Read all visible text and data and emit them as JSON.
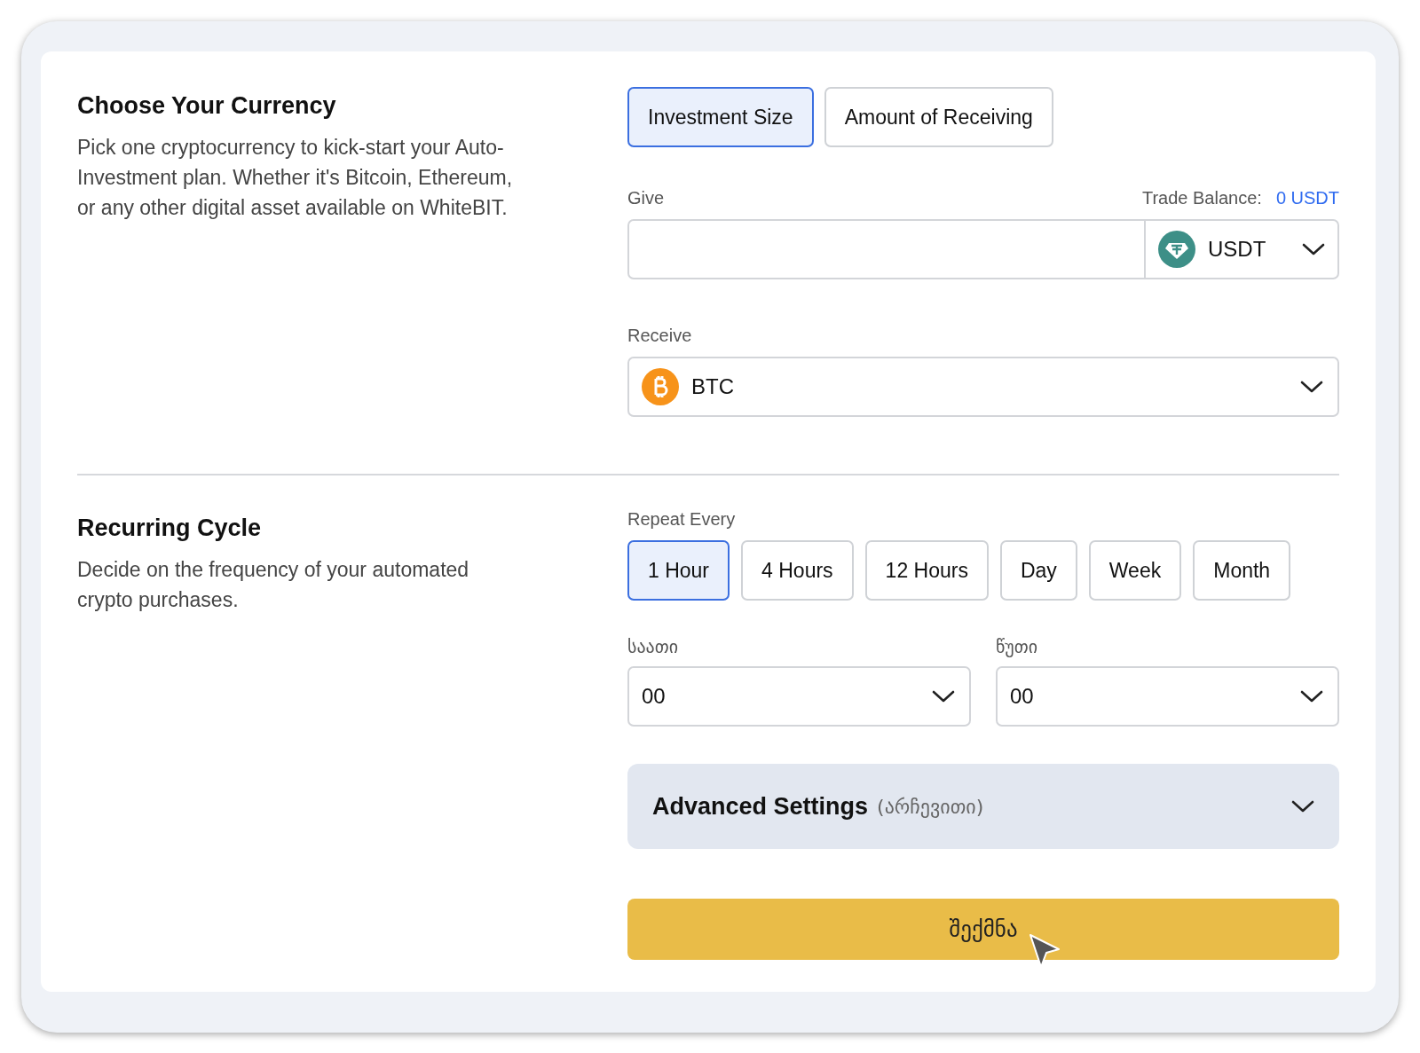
{
  "sections": [
    {
      "title": "Choose Your Currency",
      "description": "Pick one cryptocurrency to kick-start your Auto-Investment plan. Whether it's Bitcoin, Ethereum, or any other digital asset available on WhiteBIT."
    },
    {
      "title": "Recurring Cycle",
      "description": "Decide on the frequency of your automated crypto purchases."
    }
  ],
  "mode_tabs": [
    {
      "label": "Investment Size",
      "selected": true
    },
    {
      "label": "Amount of Receiving",
      "selected": false
    }
  ],
  "give": {
    "label": "Give",
    "balance_label": "Trade Balance:",
    "balance_value": "0 USDT",
    "currency": "USDT"
  },
  "receive": {
    "label": "Receive",
    "currency": "BTC"
  },
  "repeat": {
    "label": "Repeat Every",
    "options": [
      {
        "label": "1 Hour",
        "selected": true
      },
      {
        "label": "4 Hours",
        "selected": false
      },
      {
        "label": "12 Hours",
        "selected": false
      },
      {
        "label": "Day",
        "selected": false
      },
      {
        "label": "Week",
        "selected": false
      },
      {
        "label": "Month",
        "selected": false
      }
    ]
  },
  "time": [
    {
      "label": "საათი",
      "value": "00"
    },
    {
      "label": "წუთი",
      "value": "00"
    }
  ],
  "advanced": {
    "title": "Advanced Settings",
    "hint": "(არჩევითი)",
    "expanded": false
  },
  "submit": "შექმნა"
}
